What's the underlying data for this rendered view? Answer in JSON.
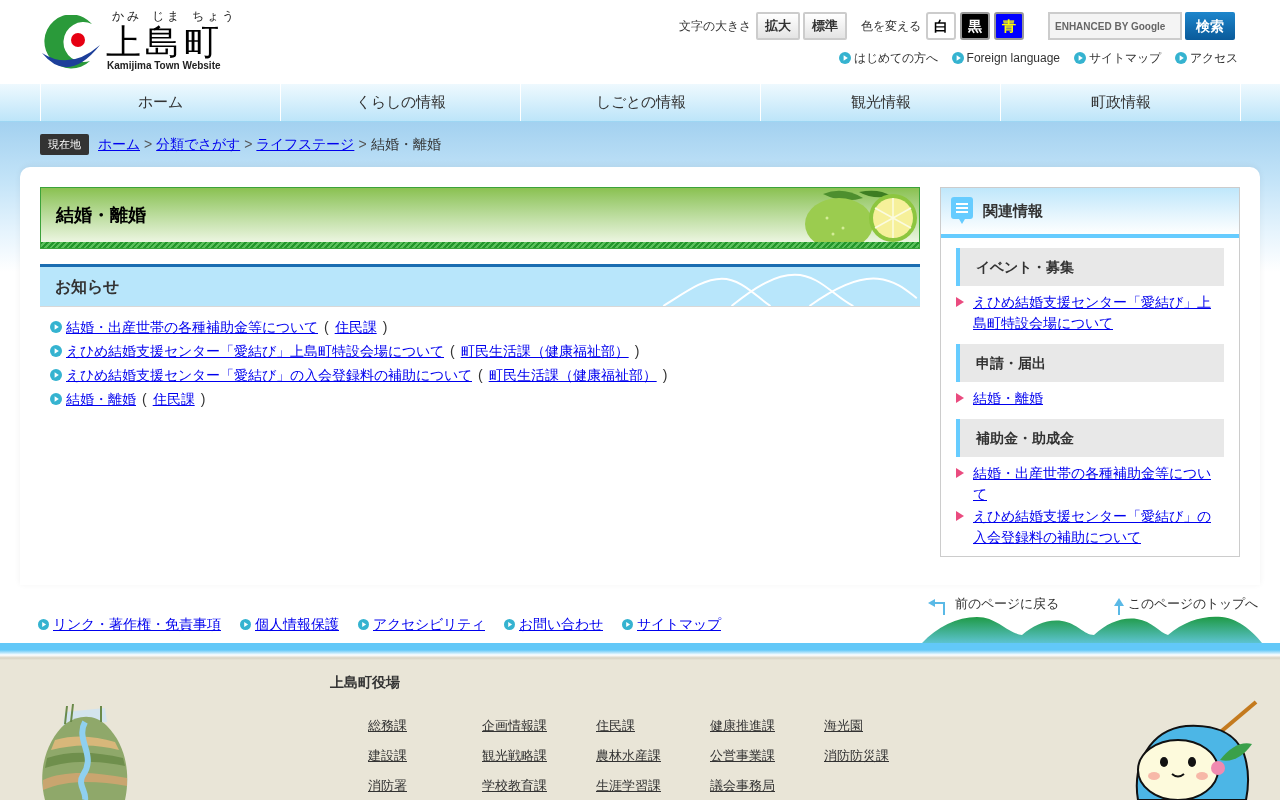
{
  "header": {
    "logo": {
      "ruby": [
        "かみ",
        "じま",
        "ちょう"
      ],
      "name": "上島町",
      "subtitle": "Kamijima Town Website"
    },
    "text_size": {
      "label": "文字の大きさ",
      "buttons": [
        "拡大",
        "標準"
      ]
    },
    "color_scheme": {
      "label": "色を変える",
      "buttons": [
        {
          "label": "白",
          "kind": "white"
        },
        {
          "label": "黒",
          "kind": "black"
        },
        {
          "label": "青",
          "kind": "blue"
        }
      ]
    },
    "search": {
      "placeholder": "ENHANCED BY Google",
      "button": "検索"
    },
    "quick_links": [
      "はじめての方へ",
      "Foreign language",
      "サイトマップ",
      "アクセス"
    ]
  },
  "nav": [
    "ホーム",
    "くらしの情報",
    "しごとの情報",
    "観光情報",
    "町政情報"
  ],
  "breadcrumb": {
    "label": "現在地",
    "trail": [
      {
        "kind": "link",
        "text": "ホーム"
      },
      {
        "kind": "separator",
        "text": ">"
      },
      {
        "kind": "link",
        "text": "分類でさがす"
      },
      {
        "kind": "separator",
        "text": ">"
      },
      {
        "kind": "link",
        "text": "ライフステージ"
      },
      {
        "kind": "separator",
        "text": ">"
      },
      {
        "kind": "current",
        "text": "結婚・離婚"
      }
    ]
  },
  "page_title": "結婚・離婚",
  "notices": {
    "title": "お知らせ",
    "items": [
      {
        "title": "結婚・出産世帯の各種補助金等について",
        "open": "(",
        "dept": "住民課",
        "close": ")"
      },
      {
        "title": "えひめ結婚支援センター「愛結び」上島町特設会場について",
        "open": "(",
        "dept": "町民生活課（健康福祉部）",
        "close": ")"
      },
      {
        "title": "えひめ結婚支援センター「愛結び」の入会登録料の補助について",
        "open": "(",
        "dept": "町民生活課（健康福祉部）",
        "close": ")"
      },
      {
        "title": "結婚・離婚",
        "open": "(",
        "dept": "住民課",
        "close": ")"
      }
    ]
  },
  "related": {
    "title": "関連情報",
    "groups": [
      {
        "heading": "イベント・募集",
        "links": [
          "えひめ結婚支援センター「愛結び」上島町特設会場について"
        ]
      },
      {
        "heading": "申請・届出",
        "links": [
          "結婚・離婚"
        ]
      },
      {
        "heading": "補助金・助成金",
        "links": [
          "結婚・出産世帯の各種補助金等について",
          "えひめ結婚支援センター「愛結び」の入会登録料の補助について"
        ]
      }
    ]
  },
  "footer_links": [
    "リンク・著作権・免責事項",
    "個人情報保護",
    "アクセシビリティ",
    "お問い合わせ",
    "サイトマップ"
  ],
  "page_nav": [
    {
      "kind": "back",
      "label": "前のページに戻る"
    },
    {
      "kind": "top",
      "label": "このページのトップへ"
    }
  ],
  "footer": {
    "office": "上島町役場",
    "departments": [
      "総務課",
      "企画情報課",
      "住民課",
      "健康推進課",
      "海光園",
      "建設課",
      "観光戦略課",
      "農林水産課",
      "公営事業課",
      "消防防災課",
      "消防署",
      "学校教育課",
      "生涯学習課",
      "議会事務局"
    ]
  }
}
